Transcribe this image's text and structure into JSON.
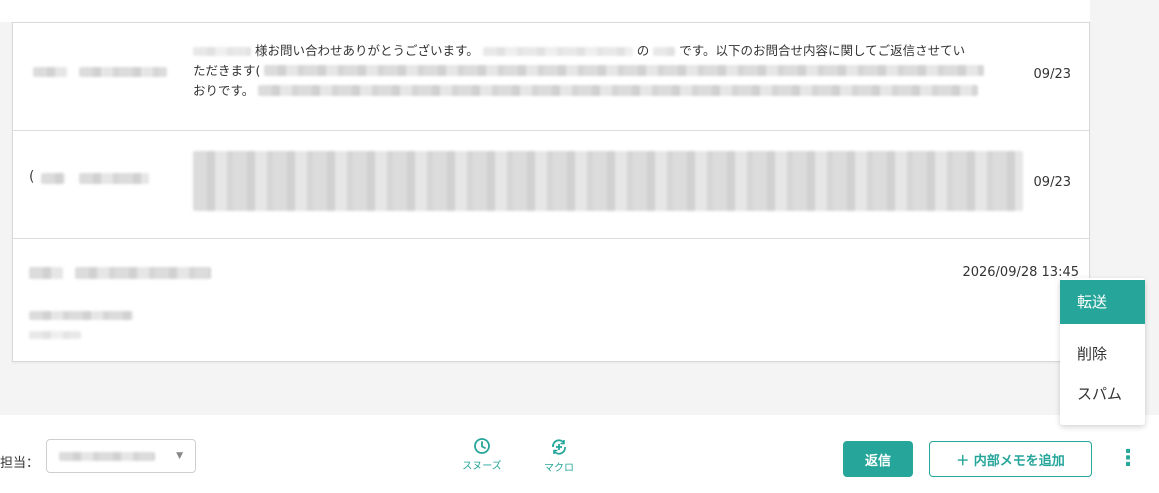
{
  "thread": {
    "messages": [
      {
        "preview_part1": "様お問い合わせありがとうございます。",
        "preview_part2": "の",
        "preview_part3": "です。以下のお問合せ内容に関してご返信させてい",
        "preview_line2": "ただきます(",
        "preview_line3": "おりです。",
        "date": "09/23"
      },
      {
        "paren": "(",
        "date": "09/23"
      },
      {
        "date": "2026/09/28 13:45"
      }
    ]
  },
  "context_menu": {
    "items": [
      "転送",
      "削除",
      "スパム"
    ]
  },
  "toolbar": {
    "assignee_label": "担当：",
    "snooze_label": "スヌーズ",
    "macro_label": "マクロ",
    "reply_label": "返信",
    "add_memo_label": "＋ 内部メモを追加",
    "more_glyph": "⋮"
  },
  "colors": {
    "accent": "#26a69a"
  }
}
